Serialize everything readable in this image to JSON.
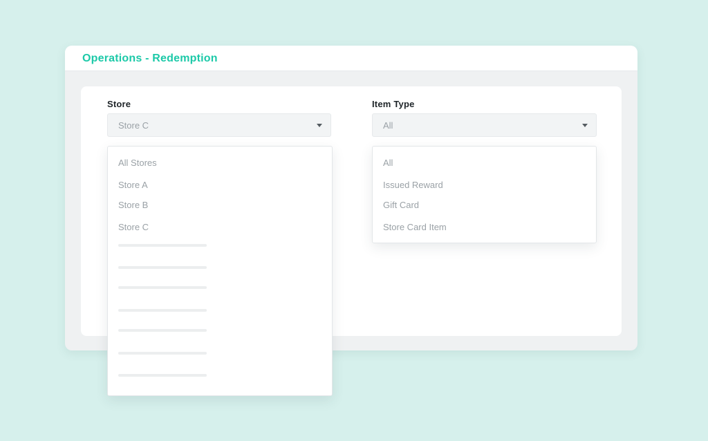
{
  "window": {
    "title": "Operations - Redemption"
  },
  "store_filter": {
    "label": "Store",
    "selected": "Store C",
    "options": [
      "All Stores",
      "Store A",
      "Store B",
      "Store C"
    ],
    "placeholder_rows": 7
  },
  "item_type_filter": {
    "label": "Item Type",
    "selected": "All",
    "options": [
      "All",
      "Issued Reward",
      "Gift Card",
      "Store Card Item"
    ]
  },
  "colors": {
    "background": "#d6f0ec",
    "accent": "#1cc9a8",
    "text_muted": "#9aa1a6",
    "label": "#1e2428"
  }
}
